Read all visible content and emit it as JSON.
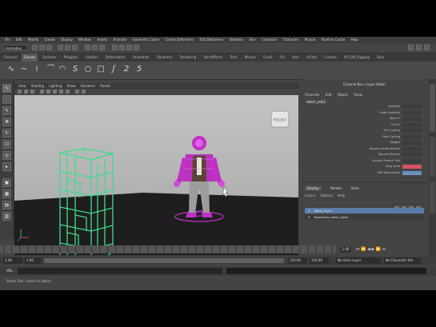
{
  "menubar": {
    "items": [
      "File",
      "Edit",
      "Modify",
      "Create",
      "Display",
      "Window",
      "Assets",
      "Animate",
      "Geometry Cache",
      "Create Deformers",
      "Edit Deformers",
      "Skeleton",
      "Skin",
      "Constrain",
      "Character",
      "Muscle",
      "Pipeline Cache",
      "Help"
    ]
  },
  "status_line": {
    "mode": "Animation"
  },
  "shelf": {
    "tabs": [
      "General",
      "Curves",
      "Surfaces",
      "Polygons",
      "Subdivs",
      "Deformation",
      "Animation",
      "Dynamics",
      "Rendering",
      "PaintEffects",
      "Toon",
      "Muscle",
      "Fluids",
      "Fur",
      "Hair",
      "nCloth",
      "Custom",
      "XP_SAP_Rigging",
      "Rear"
    ],
    "active_tab": "Curves",
    "icons": [
      "curve-cv",
      "curve-ep",
      "curve-pencil",
      "curve-arc",
      "curve-arc2",
      "curve-bezier",
      "curve-circle",
      "curve-square",
      "curve-s",
      "curve-2",
      "curve-5"
    ]
  },
  "viewport": {
    "menu": [
      "View",
      "Shading",
      "Lighting",
      "Show",
      "Renderer",
      "Panels"
    ],
    "view_cube_label": "FRONT",
    "colors": {
      "wireframe": "#3fdc8a",
      "character_highlight": "#c02fc6",
      "viewport_bg_top": "#b9b9b9",
      "floor": "#1f1f1f"
    }
  },
  "channel_box": {
    "title": "Channel Box / Layer Editor",
    "menu": [
      "Channels",
      "Edit",
      "Object",
      "Show"
    ],
    "object_name": "Hatch_Jnt22",
    "attributes": [
      {
        "name": "Visibility"
      },
      {
        "name": "Shaft Visibility"
      },
      {
        "name": "Mode Y"
      },
      {
        "name": "Fold Y"
      },
      {
        "name": "Pre Cycling"
      },
      {
        "name": "Post Cycling"
      },
      {
        "name": "Weight"
      },
      {
        "name": "Squash Scale Stretch"
      },
      {
        "name": "Squash Stretch"
      },
      {
        "name": "Squash Stretch Opt"
      },
      {
        "name": "Step Grad"
      },
      {
        "name": "Stiff Step Points"
      }
    ]
  },
  "layer_editor": {
    "tabs": [
      "Display",
      "Render",
      "Anim"
    ],
    "active_tab": "Display",
    "menu": [
      "Layers",
      "Options",
      "Help"
    ],
    "layers": [
      {
        "flags": "V",
        "name": "Walk_Layer",
        "selected": true
      },
      {
        "flags": "V",
        "name": "SpanChar_mesh_layer",
        "selected": false
      }
    ]
  },
  "time_range": {
    "current_frame": "1.00",
    "start": "1.00",
    "range_start": "1.00",
    "range_end": "120.00",
    "end": "120.00",
    "anim_layer": "No Anim Layer",
    "character_set": "No Character Set"
  },
  "command_line": {
    "label": "MEL"
  },
  "help_line": {
    "text": "Select Tool: select an object"
  }
}
